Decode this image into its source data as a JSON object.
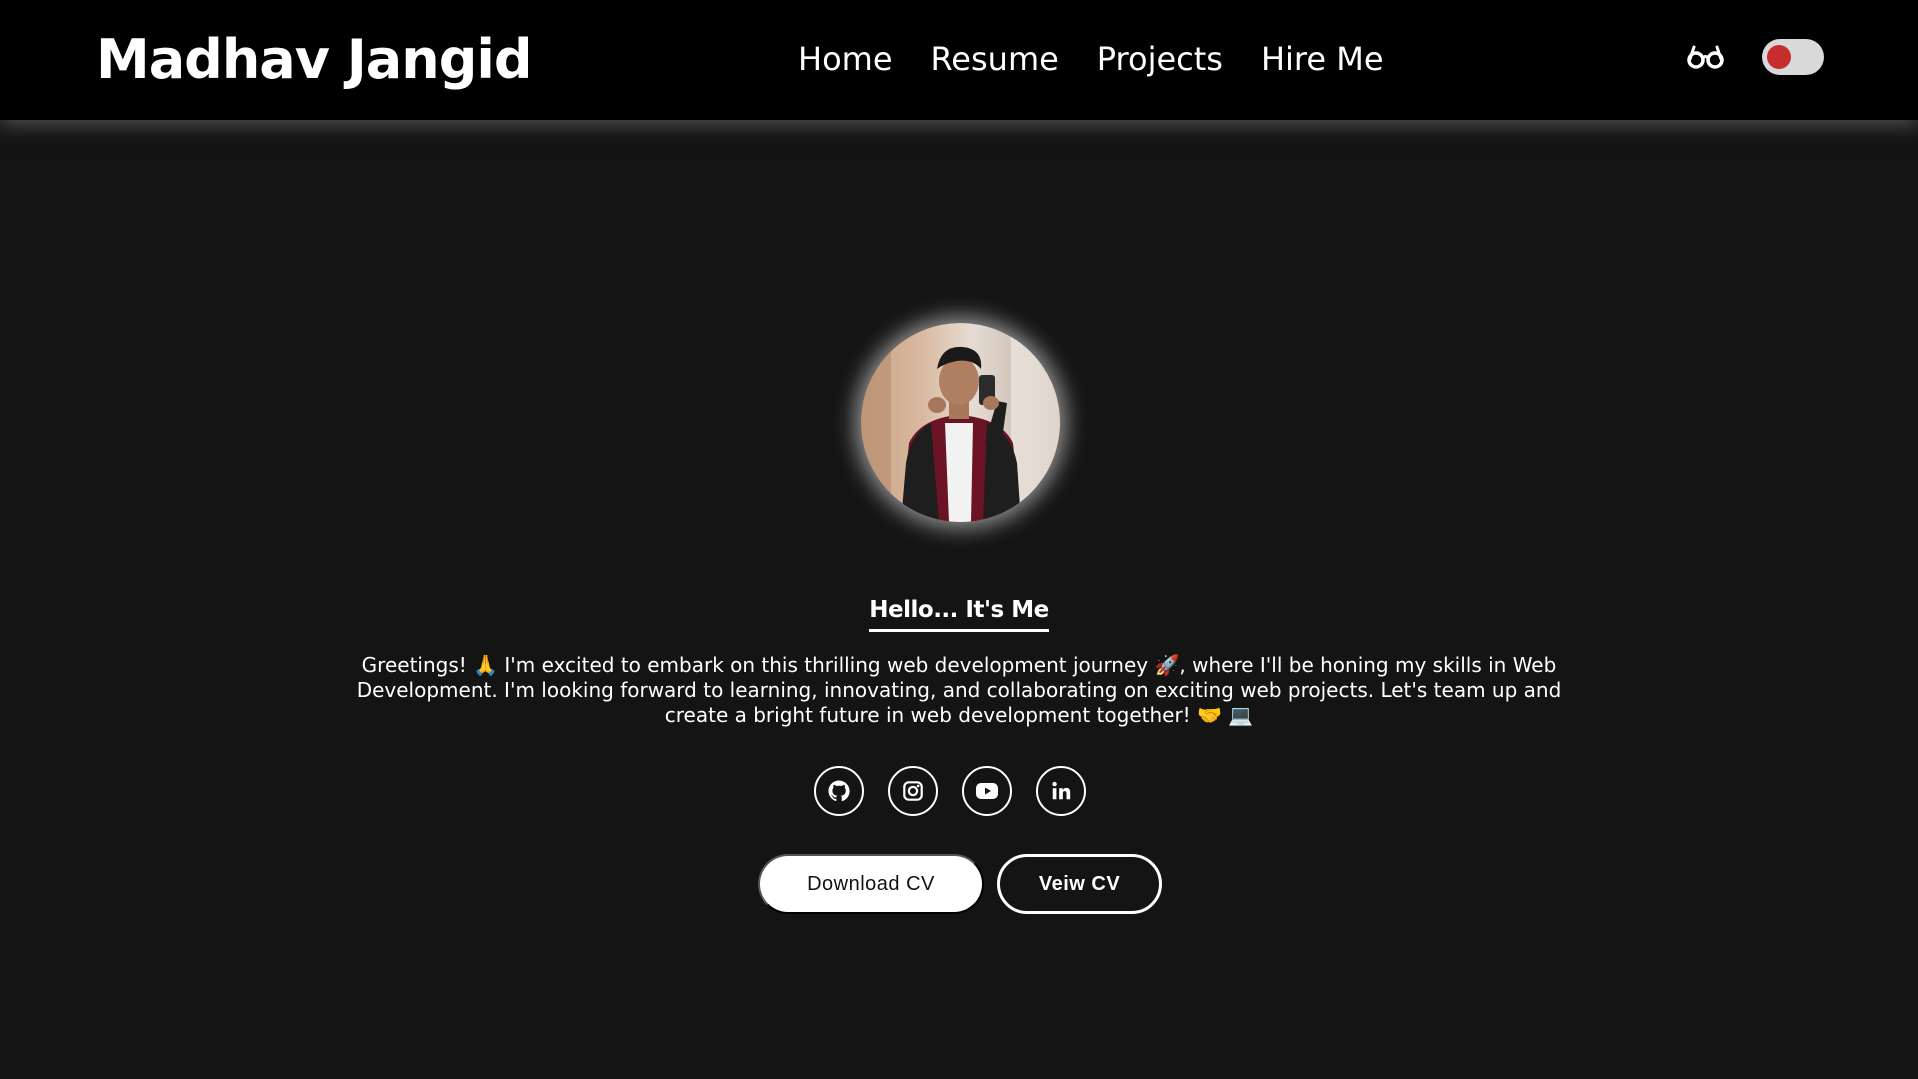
{
  "header": {
    "brand": "Madhav Jangid",
    "nav": [
      "Home",
      "Resume",
      "Projects",
      "Hire Me"
    ],
    "reading_mode_icon": "glasses-icon",
    "theme_toggle": {
      "state": "off",
      "knob_color": "#c62d2d"
    }
  },
  "profile": {
    "avatar_alt": "profile-photo",
    "greeting_title": "Hello... It's Me",
    "intro_line1": "Greetings! 🙏 I'm excited to embark on this thrilling web development journey 🚀, where I'll be honing my skills in Web",
    "intro_line2": "Development. I'm looking forward to learning, innovating, and collaborating on exciting web projects. Let's team up and",
    "intro_line3": "create a bright future in web development together! 🤝 💻"
  },
  "socials": [
    "github-icon",
    "instagram-icon",
    "youtube-icon",
    "linkedin-icon"
  ],
  "actions": {
    "download_label": "Download CV",
    "view_label": "Veiw CV"
  },
  "colors": {
    "page_bg": "#141414",
    "navbar_bg": "#000000",
    "text": "#ffffff"
  }
}
